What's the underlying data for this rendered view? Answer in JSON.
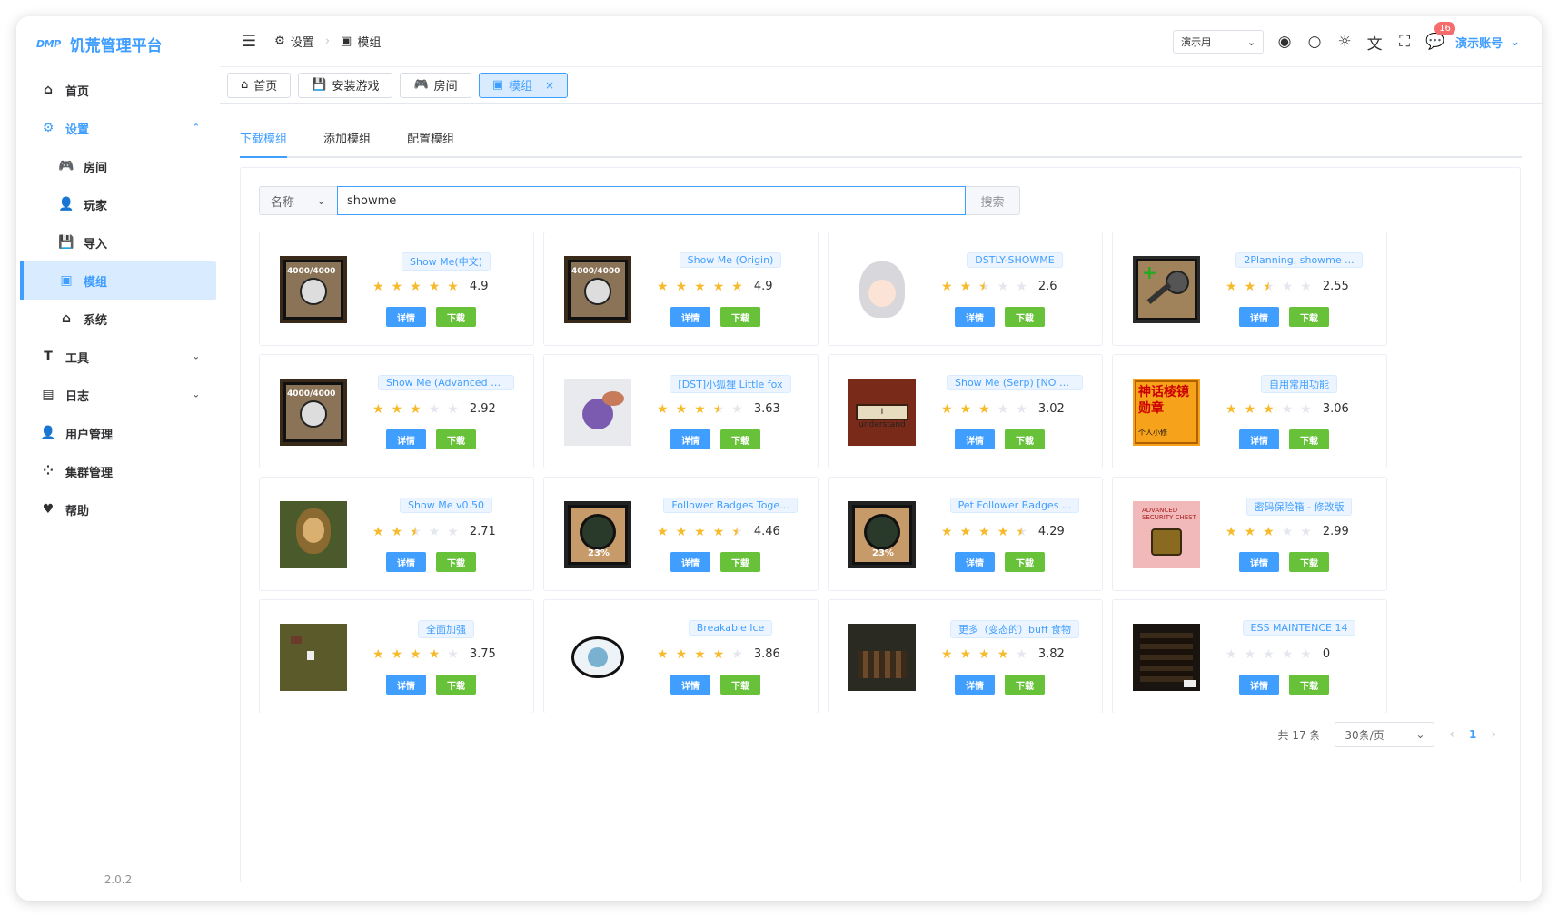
{
  "app": {
    "logo_mark": "DMP",
    "title": "饥荒管理平台",
    "version": "2.0.2"
  },
  "sidebar": {
    "items": [
      {
        "label": "首页",
        "icon": "home-icon"
      },
      {
        "label": "设置",
        "icon": "gear-icon",
        "open": true
      },
      {
        "label": "房间",
        "icon": "gamepad-icon",
        "sub": true
      },
      {
        "label": "玩家",
        "icon": "user-icon",
        "sub": true
      },
      {
        "label": "导入",
        "icon": "save-icon",
        "sub": true
      },
      {
        "label": "模组",
        "icon": "box-icon",
        "sub": true,
        "active": true
      },
      {
        "label": "系统",
        "icon": "house-gear-icon",
        "sub": true
      },
      {
        "label": "工具",
        "icon": "hammer-icon"
      },
      {
        "label": "日志",
        "icon": "log-icon"
      },
      {
        "label": "用户管理",
        "icon": "user-manage-icon"
      },
      {
        "label": "集群管理",
        "icon": "cluster-icon"
      },
      {
        "label": "帮助",
        "icon": "help-icon"
      }
    ]
  },
  "header": {
    "breadcrumb": [
      "设置",
      "模组"
    ],
    "demo_select": "演示用",
    "notification_count": "16",
    "account": "演示账号"
  },
  "tags": [
    {
      "label": "首页"
    },
    {
      "label": "安装游戏"
    },
    {
      "label": "房间"
    },
    {
      "label": "模组",
      "active": true
    }
  ],
  "tabs": [
    "下载模组",
    "添加模组",
    "配置模组"
  ],
  "search": {
    "type": "名称",
    "value": "showme",
    "button": "搜索"
  },
  "buttons": {
    "info": "详情",
    "download": "下载"
  },
  "mods": [
    {
      "name": "Show Me(中文)",
      "rating": 4.9,
      "score": "4.9",
      "thumb": "showme"
    },
    {
      "name": "Show Me (Origin)",
      "rating": 4.9,
      "score": "4.9",
      "thumb": "showme"
    },
    {
      "name": "DSTLY-SHOWME",
      "rating": 2.6,
      "score": "2.6",
      "thumb": "anime"
    },
    {
      "name": "2Planning, showme ...",
      "rating": 2.55,
      "score": "2.55",
      "thumb": "hammer"
    },
    {
      "name": "Show Me (Advanced Se...",
      "rating": 2.92,
      "score": "2.92",
      "thumb": "showme"
    },
    {
      "name": "[DST]小狐狸 Little fox",
      "rating": 3.63,
      "score": "3.63",
      "thumb": "fox"
    },
    {
      "name": "Show Me (Serp) [NO U...",
      "rating": 3.02,
      "score": "3.02",
      "thumb": "sign"
    },
    {
      "name": "自用常用功能",
      "rating": 3.06,
      "score": "3.06",
      "thumb": "chinese"
    },
    {
      "name": "Show Me v0.50",
      "rating": 2.71,
      "score": "2.71",
      "thumb": "mona"
    },
    {
      "name": "Follower Badges Toge...",
      "rating": 4.46,
      "score": "4.46",
      "thumb": "badge"
    },
    {
      "name": "Pet Follower Badges ...",
      "rating": 4.29,
      "score": "4.29",
      "thumb": "badge"
    },
    {
      "name": "密码保险箱 - 修改版",
      "rating": 2.99,
      "score": "2.99",
      "thumb": "chest"
    },
    {
      "name": "全面加强",
      "rating": 3.75,
      "score": "3.75",
      "thumb": "field"
    },
    {
      "name": "Breakable Ice",
      "rating": 3.86,
      "score": "3.86",
      "thumb": "ice"
    },
    {
      "name": "更多（变态的）buff 食物",
      "rating": 3.82,
      "score": "3.82",
      "thumb": "crowd"
    },
    {
      "name": "ESS MAINTENCE 14",
      "rating": 0,
      "score": "0",
      "thumb": "dark"
    }
  ],
  "pagination": {
    "total": "共 17 条",
    "page_size": "30条/页",
    "current": "1"
  },
  "colors": {
    "primary": "#409eff",
    "success": "#67c23a",
    "star": "#f7ba2a",
    "danger": "#f56c6c"
  }
}
